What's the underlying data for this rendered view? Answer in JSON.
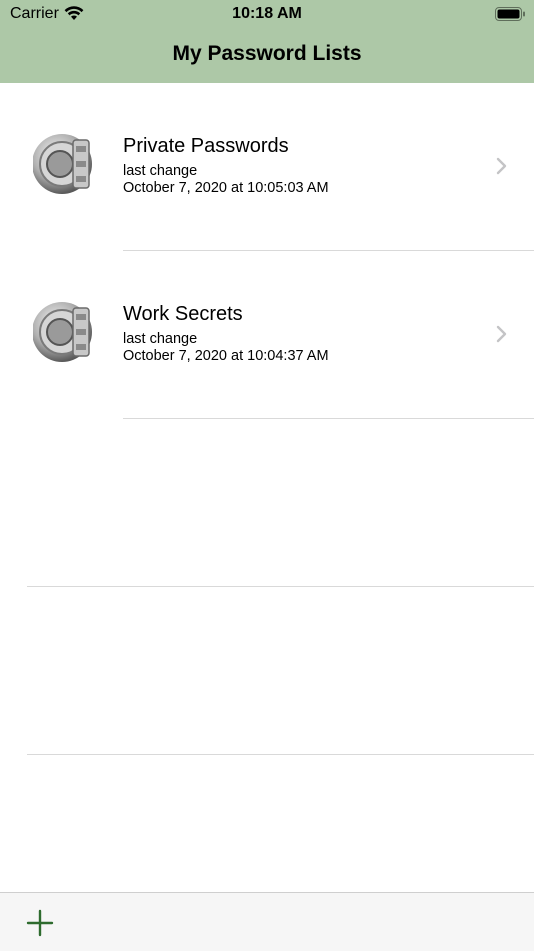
{
  "status_bar": {
    "carrier": "Carrier",
    "time": "10:18 AM",
    "wifi_icon": "wifi-icon",
    "battery_icon": "battery-icon"
  },
  "nav": {
    "title": "My Password Lists"
  },
  "lists": [
    {
      "title": "Private Passwords",
      "subtitle": "last change",
      "date": "October 7, 2020 at 10:05:03 AM",
      "icon": "vault-icon"
    },
    {
      "title": "Work Secrets",
      "subtitle": "last change",
      "date": "October 7, 2020 at 10:04:37 AM",
      "icon": "vault-icon"
    }
  ],
  "toolbar": {
    "add_icon": "plus-icon"
  },
  "colors": {
    "nav_background": "#adc8a7",
    "accent": "#2e6b2e",
    "chevron": "#c4c4c6"
  }
}
